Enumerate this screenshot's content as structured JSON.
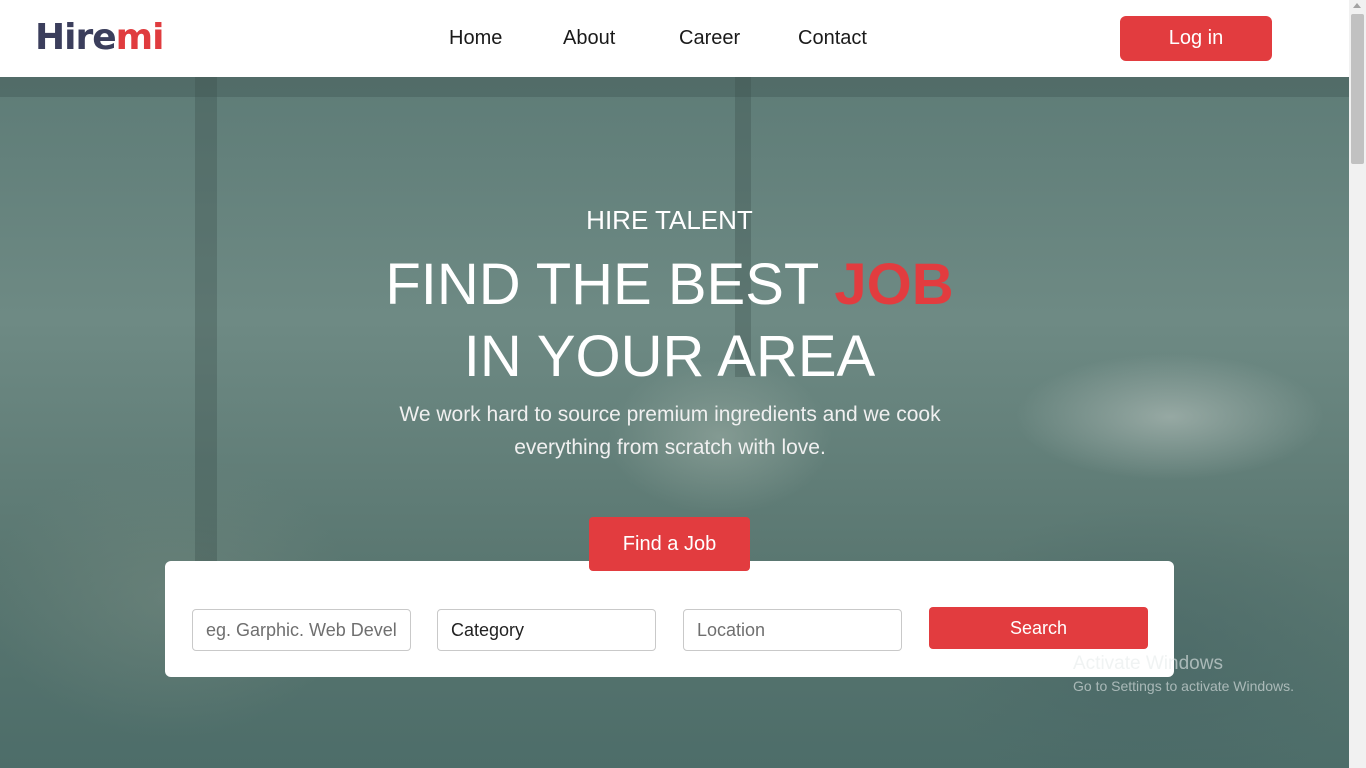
{
  "brand": {
    "logo_part1": "Hire",
    "logo_part2": "mi"
  },
  "nav": {
    "items": [
      "Home",
      "About",
      "Career",
      "Contact"
    ]
  },
  "header": {
    "login_label": "Log in"
  },
  "hero": {
    "eyebrow": "HIRE TALENT",
    "title_line1_prefix": "FIND THE BEST ",
    "title_line1_accent": "JOB",
    "title_line2": "IN YOUR AREA",
    "description": "We work hard to source premium ingredients and we cook everything from scratch with love.",
    "cta_label": "Find a Job"
  },
  "search": {
    "keyword_placeholder": "eg. Garphic. Web Developer",
    "category_value": "Category",
    "location_placeholder": "Location",
    "button_label": "Search"
  },
  "watermark": {
    "title": "Activate Windows",
    "subtitle": "Go to Settings to activate Windows."
  },
  "colors": {
    "accent": "#e23c3f",
    "logo_dark": "#3b3e5c"
  }
}
